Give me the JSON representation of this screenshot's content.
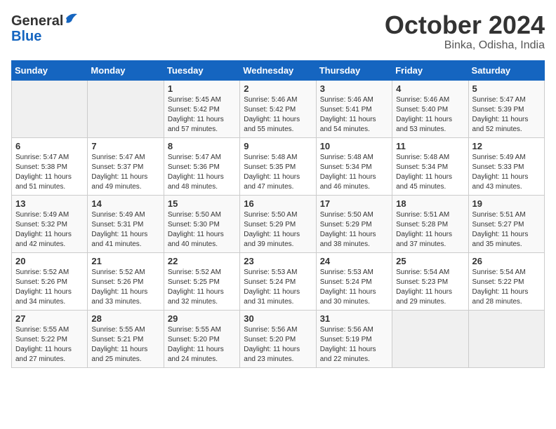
{
  "logo": {
    "general": "General",
    "blue": "Blue"
  },
  "title": "October 2024",
  "subtitle": "Binka, Odisha, India",
  "days_of_week": [
    "Sunday",
    "Monday",
    "Tuesday",
    "Wednesday",
    "Thursday",
    "Friday",
    "Saturday"
  ],
  "weeks": [
    [
      {
        "day": "",
        "sunrise": "",
        "sunset": "",
        "daylight": ""
      },
      {
        "day": "",
        "sunrise": "",
        "sunset": "",
        "daylight": ""
      },
      {
        "day": "1",
        "sunrise": "Sunrise: 5:45 AM",
        "sunset": "Sunset: 5:42 PM",
        "daylight": "Daylight: 11 hours and 57 minutes."
      },
      {
        "day": "2",
        "sunrise": "Sunrise: 5:46 AM",
        "sunset": "Sunset: 5:42 PM",
        "daylight": "Daylight: 11 hours and 55 minutes."
      },
      {
        "day": "3",
        "sunrise": "Sunrise: 5:46 AM",
        "sunset": "Sunset: 5:41 PM",
        "daylight": "Daylight: 11 hours and 54 minutes."
      },
      {
        "day": "4",
        "sunrise": "Sunrise: 5:46 AM",
        "sunset": "Sunset: 5:40 PM",
        "daylight": "Daylight: 11 hours and 53 minutes."
      },
      {
        "day": "5",
        "sunrise": "Sunrise: 5:47 AM",
        "sunset": "Sunset: 5:39 PM",
        "daylight": "Daylight: 11 hours and 52 minutes."
      }
    ],
    [
      {
        "day": "6",
        "sunrise": "Sunrise: 5:47 AM",
        "sunset": "Sunset: 5:38 PM",
        "daylight": "Daylight: 11 hours and 51 minutes."
      },
      {
        "day": "7",
        "sunrise": "Sunrise: 5:47 AM",
        "sunset": "Sunset: 5:37 PM",
        "daylight": "Daylight: 11 hours and 49 minutes."
      },
      {
        "day": "8",
        "sunrise": "Sunrise: 5:47 AM",
        "sunset": "Sunset: 5:36 PM",
        "daylight": "Daylight: 11 hours and 48 minutes."
      },
      {
        "day": "9",
        "sunrise": "Sunrise: 5:48 AM",
        "sunset": "Sunset: 5:35 PM",
        "daylight": "Daylight: 11 hours and 47 minutes."
      },
      {
        "day": "10",
        "sunrise": "Sunrise: 5:48 AM",
        "sunset": "Sunset: 5:34 PM",
        "daylight": "Daylight: 11 hours and 46 minutes."
      },
      {
        "day": "11",
        "sunrise": "Sunrise: 5:48 AM",
        "sunset": "Sunset: 5:34 PM",
        "daylight": "Daylight: 11 hours and 45 minutes."
      },
      {
        "day": "12",
        "sunrise": "Sunrise: 5:49 AM",
        "sunset": "Sunset: 5:33 PM",
        "daylight": "Daylight: 11 hours and 43 minutes."
      }
    ],
    [
      {
        "day": "13",
        "sunrise": "Sunrise: 5:49 AM",
        "sunset": "Sunset: 5:32 PM",
        "daylight": "Daylight: 11 hours and 42 minutes."
      },
      {
        "day": "14",
        "sunrise": "Sunrise: 5:49 AM",
        "sunset": "Sunset: 5:31 PM",
        "daylight": "Daylight: 11 hours and 41 minutes."
      },
      {
        "day": "15",
        "sunrise": "Sunrise: 5:50 AM",
        "sunset": "Sunset: 5:30 PM",
        "daylight": "Daylight: 11 hours and 40 minutes."
      },
      {
        "day": "16",
        "sunrise": "Sunrise: 5:50 AM",
        "sunset": "Sunset: 5:29 PM",
        "daylight": "Daylight: 11 hours and 39 minutes."
      },
      {
        "day": "17",
        "sunrise": "Sunrise: 5:50 AM",
        "sunset": "Sunset: 5:29 PM",
        "daylight": "Daylight: 11 hours and 38 minutes."
      },
      {
        "day": "18",
        "sunrise": "Sunrise: 5:51 AM",
        "sunset": "Sunset: 5:28 PM",
        "daylight": "Daylight: 11 hours and 37 minutes."
      },
      {
        "day": "19",
        "sunrise": "Sunrise: 5:51 AM",
        "sunset": "Sunset: 5:27 PM",
        "daylight": "Daylight: 11 hours and 35 minutes."
      }
    ],
    [
      {
        "day": "20",
        "sunrise": "Sunrise: 5:52 AM",
        "sunset": "Sunset: 5:26 PM",
        "daylight": "Daylight: 11 hours and 34 minutes."
      },
      {
        "day": "21",
        "sunrise": "Sunrise: 5:52 AM",
        "sunset": "Sunset: 5:26 PM",
        "daylight": "Daylight: 11 hours and 33 minutes."
      },
      {
        "day": "22",
        "sunrise": "Sunrise: 5:52 AM",
        "sunset": "Sunset: 5:25 PM",
        "daylight": "Daylight: 11 hours and 32 minutes."
      },
      {
        "day": "23",
        "sunrise": "Sunrise: 5:53 AM",
        "sunset": "Sunset: 5:24 PM",
        "daylight": "Daylight: 11 hours and 31 minutes."
      },
      {
        "day": "24",
        "sunrise": "Sunrise: 5:53 AM",
        "sunset": "Sunset: 5:24 PM",
        "daylight": "Daylight: 11 hours and 30 minutes."
      },
      {
        "day": "25",
        "sunrise": "Sunrise: 5:54 AM",
        "sunset": "Sunset: 5:23 PM",
        "daylight": "Daylight: 11 hours and 29 minutes."
      },
      {
        "day": "26",
        "sunrise": "Sunrise: 5:54 AM",
        "sunset": "Sunset: 5:22 PM",
        "daylight": "Daylight: 11 hours and 28 minutes."
      }
    ],
    [
      {
        "day": "27",
        "sunrise": "Sunrise: 5:55 AM",
        "sunset": "Sunset: 5:22 PM",
        "daylight": "Daylight: 11 hours and 27 minutes."
      },
      {
        "day": "28",
        "sunrise": "Sunrise: 5:55 AM",
        "sunset": "Sunset: 5:21 PM",
        "daylight": "Daylight: 11 hours and 25 minutes."
      },
      {
        "day": "29",
        "sunrise": "Sunrise: 5:55 AM",
        "sunset": "Sunset: 5:20 PM",
        "daylight": "Daylight: 11 hours and 24 minutes."
      },
      {
        "day": "30",
        "sunrise": "Sunrise: 5:56 AM",
        "sunset": "Sunset: 5:20 PM",
        "daylight": "Daylight: 11 hours and 23 minutes."
      },
      {
        "day": "31",
        "sunrise": "Sunrise: 5:56 AM",
        "sunset": "Sunset: 5:19 PM",
        "daylight": "Daylight: 11 hours and 22 minutes."
      },
      {
        "day": "",
        "sunrise": "",
        "sunset": "",
        "daylight": ""
      },
      {
        "day": "",
        "sunrise": "",
        "sunset": "",
        "daylight": ""
      }
    ]
  ]
}
